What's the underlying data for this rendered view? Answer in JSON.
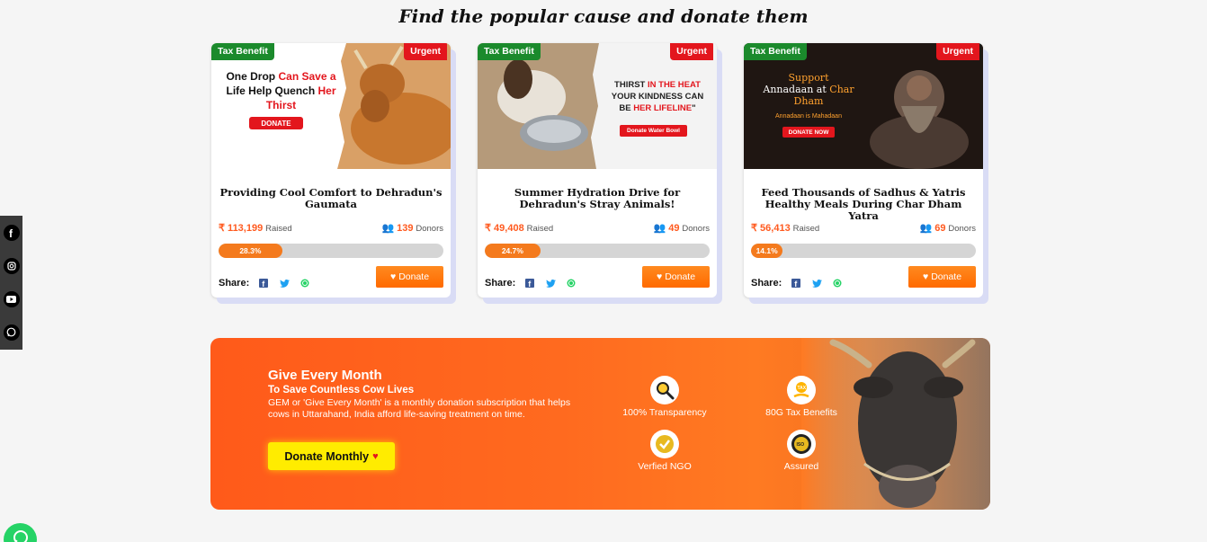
{
  "heading": "Find the popular cause and donate them",
  "cards": [
    {
      "badge_tax": "Tax Benefit",
      "badge_urgent": "Urgent",
      "img_text": [
        "One Drop ",
        "Can Save a",
        "Life Help Quench ",
        "Her",
        "Thirst"
      ],
      "img_button": "DONATE",
      "title": "Providing Cool Comfort to Dehradun's Gaumata",
      "raised": "₹ 113,199",
      "raised_label": "Raised",
      "donors": "139",
      "donors_label": "Donors",
      "progress_label": "28.3%",
      "progress": 28.3,
      "share_label": "Share:",
      "donate_label": "Donate"
    },
    {
      "badge_tax": "Tax Benefit",
      "badge_urgent": "Urgent",
      "img_text": [
        "THIRST ",
        "IN THE HEAT",
        "YOUR KINDNESS CAN",
        "BE ",
        "HER LIFELINE",
        "\""
      ],
      "img_button": "Donate Water Bowl",
      "title": "Summer Hydration Drive for Dehradun's Stray Animals!",
      "raised": "₹ 49,408",
      "raised_label": "Raised",
      "donors": "49",
      "donors_label": "Donors",
      "progress_label": "24.7%",
      "progress": 24.7,
      "share_label": "Share:",
      "donate_label": "Donate"
    },
    {
      "badge_tax": "Tax Benefit",
      "badge_urgent": "Urgent",
      "img_text": [
        "Support",
        "Annadaan at ",
        "Char",
        "Dham",
        "Annadaan is Mahadaan"
      ],
      "img_button": "DONATE NOW",
      "title": "Feed Thousands of Sadhus & Yatris Healthy Meals During Char Dham Yatra",
      "raised": "₹ 56,413",
      "raised_label": "Raised",
      "donors": "69",
      "donors_label": "Donors",
      "progress_label": "14.1%",
      "progress": 14.1,
      "share_label": "Share:",
      "donate_label": "Donate"
    }
  ],
  "banner": {
    "title": "Give Every Month",
    "subtitle": "To Save Countless Cow Lives",
    "description": "GEM or 'Give Every Month' is a monthly donation subscription that helps cows in Uttarahand, India afford life-saving treatment on time.",
    "button": "Donate Monthly",
    "features": [
      {
        "label": "100% Transparency",
        "icon": "magnifier-icon"
      },
      {
        "label": "80G Tax Benefits",
        "icon": "tax-hand-icon"
      },
      {
        "label": "Verfied NGO",
        "icon": "verified-badge-icon"
      },
      {
        "label": "Assured",
        "icon": "iso-seal-icon"
      }
    ]
  },
  "colors": {
    "accent": "#ff5a1f",
    "tax_badge": "#1b8a2c",
    "urgent_badge": "#e3161d",
    "donate_monthly": "#ffec00"
  }
}
